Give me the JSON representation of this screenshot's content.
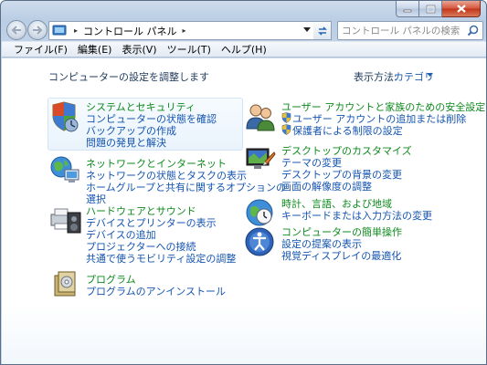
{
  "window": {
    "address": {
      "crumb": "コントロール パネル"
    },
    "search": {
      "placeholder": "コントロール パネルの検索"
    }
  },
  "menu": [
    "ファイル(F)",
    "編集(E)",
    "表示(V)",
    "ツール(T)",
    "ヘルプ(H)"
  ],
  "header": {
    "title": "コンピューターの設定を調整します",
    "view_by_label": "表示方法:",
    "view_by_value": "カテゴリ"
  },
  "categories": {
    "system": {
      "title": "システムとセキュリティ",
      "links": [
        "コンピューターの状態を確認",
        "バックアップの作成",
        "問題の発見と解決"
      ]
    },
    "network": {
      "title": "ネットワークとインターネット",
      "links": [
        "ネットワークの状態とタスクの表示",
        "ホームグループと共有に関するオプションの",
        "選択"
      ]
    },
    "hardware": {
      "title": "ハードウェアとサウンド",
      "links": [
        "デバイスとプリンターの表示",
        "デバイスの追加",
        "プロジェクターへの接続",
        "共通で使うモビリティ設定の調整"
      ]
    },
    "programs": {
      "title": "プログラム",
      "links": [
        "プログラムのアンインストール"
      ]
    },
    "users": {
      "title": "ユーザー アカウントと家族のための安全設定",
      "links": [
        "ユーザー アカウントの追加または削除",
        "保護者による制限の設定"
      ]
    },
    "appearance": {
      "title": "デスクトップのカスタマイズ",
      "links": [
        "テーマの変更",
        "デスクトップの背景の変更",
        "画面の解像度の調整"
      ]
    },
    "clock": {
      "title": "時計、言語、および地域",
      "links": [
        "キーボードまたは入力方法の変更"
      ]
    },
    "ease": {
      "title": "コンピューターの簡単操作",
      "links": [
        "設定の提案の表示",
        "視覚ディスプレイの最適化"
      ]
    }
  }
}
